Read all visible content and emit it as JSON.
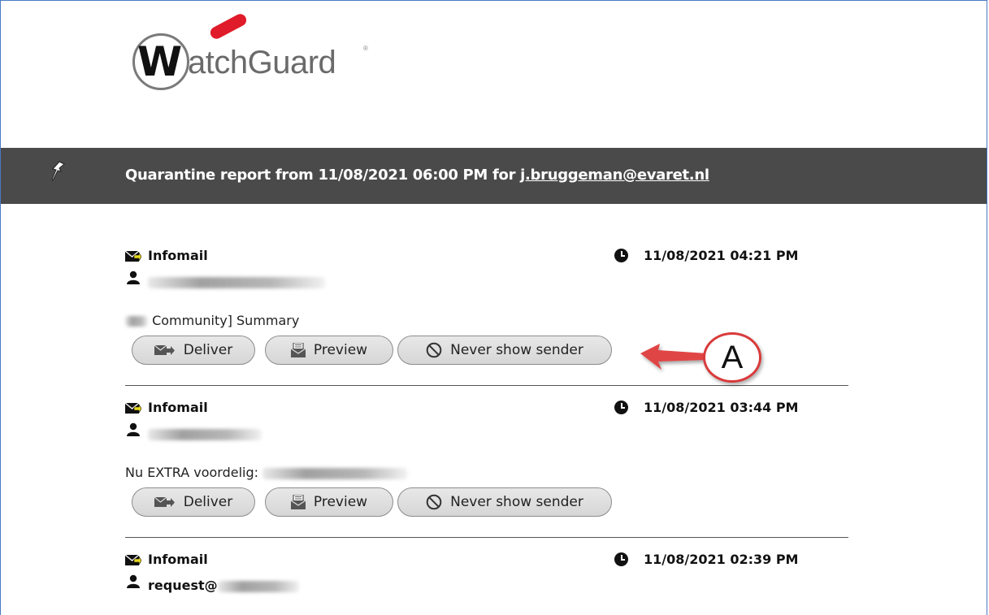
{
  "logo": {
    "initial": "W",
    "rest": "atchGuard",
    "tm": "®"
  },
  "banner": {
    "prefix": "Quarantine report from 11/08/2021 06:00 PM for ",
    "email": "j.bruggeman@evaret.nl"
  },
  "items": [
    {
      "type": "Infomail",
      "time": "11/08/2021 04:21 PM",
      "sender": "",
      "subject": "Community] Summary",
      "buttons": {
        "deliver": "Deliver",
        "preview": "Preview",
        "never": "Never show sender"
      }
    },
    {
      "type": "Infomail",
      "time": "11/08/2021 03:44 PM",
      "sender": "",
      "subject": "Nu EXTRA voordelig: ",
      "buttons": {
        "deliver": "Deliver",
        "preview": "Preview",
        "never": "Never show sender"
      }
    },
    {
      "type": "Infomail",
      "time": "11/08/2021 02:39 PM",
      "sender": "request@",
      "subject": ""
    }
  ],
  "annotation": {
    "label": "A"
  },
  "colors": {
    "banner": "#4a4a4a",
    "annotation": "#d93b3b",
    "logo_swoosh": "#e01b2a"
  }
}
